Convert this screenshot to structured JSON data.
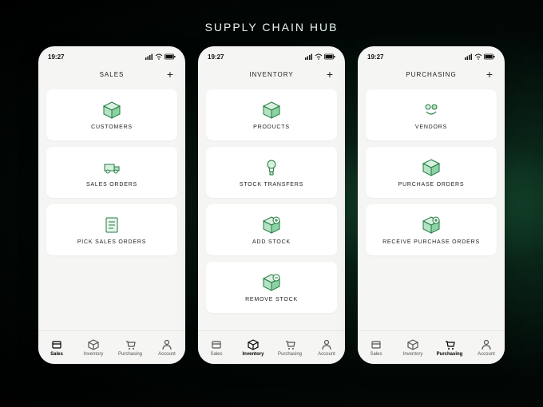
{
  "page_title": "SUPPLY CHAIN HUB",
  "status": {
    "time": "19:27"
  },
  "tabs": {
    "sales": "Sales",
    "inventory": "Inventory",
    "purchasing": "Purchasing",
    "account": "Account"
  },
  "phones": [
    {
      "header": "SALES",
      "active_tab": "sales",
      "cards": [
        {
          "label": "CUSTOMERS",
          "icon": "customers"
        },
        {
          "label": "SALES ORDERS",
          "icon": "sales-orders"
        },
        {
          "label": "PICK SALES ORDERS",
          "icon": "pick-sales-orders"
        }
      ]
    },
    {
      "header": "INVENTORY",
      "active_tab": "inventory",
      "cards": [
        {
          "label": "PRODUCTS",
          "icon": "products"
        },
        {
          "label": "STOCK TRANSFERS",
          "icon": "stock-transfers"
        },
        {
          "label": "ADD STOCK",
          "icon": "add-stock"
        },
        {
          "label": "REMOVE STOCK",
          "icon": "remove-stock"
        }
      ]
    },
    {
      "header": "PURCHASING",
      "active_tab": "purchasing",
      "cards": [
        {
          "label": "VENDORS",
          "icon": "vendors"
        },
        {
          "label": "PURCHASE ORDERS",
          "icon": "purchase-orders"
        },
        {
          "label": "RECEIVE PURCHASE ORDERS",
          "icon": "receive-purchase-orders"
        }
      ]
    }
  ]
}
